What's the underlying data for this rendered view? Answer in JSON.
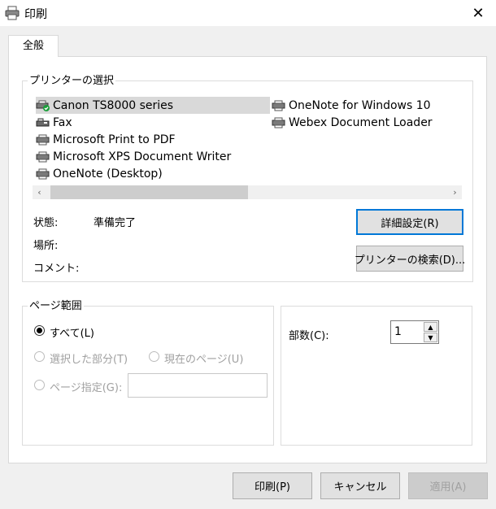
{
  "window": {
    "title": "印刷",
    "close_glyph": "✕",
    "icon": "printer-icon"
  },
  "tabs": [
    {
      "label": "全般",
      "active": true
    }
  ],
  "printer_select": {
    "group_label": "プリンターの選択",
    "printers_col1": [
      {
        "name": "Canon TS8000 series",
        "icon": "default-printer-icon",
        "selected": true
      },
      {
        "name": "Fax",
        "icon": "fax-icon",
        "selected": false
      },
      {
        "name": "Microsoft Print to PDF",
        "icon": "printer-icon",
        "selected": false
      },
      {
        "name": "Microsoft XPS Document Writer",
        "icon": "printer-icon",
        "selected": false
      },
      {
        "name": "OneNote (Desktop)",
        "icon": "printer-icon",
        "selected": false
      }
    ],
    "printers_col2": [
      {
        "name": "OneNote for Windows 10",
        "icon": "printer-icon",
        "selected": false
      },
      {
        "name": "Webex Document Loader",
        "icon": "printer-icon",
        "selected": false
      }
    ],
    "scroll_left": "‹",
    "scroll_right": "›",
    "status_label": "状態:",
    "status_value": "準備完了",
    "location_label": "場所:",
    "location_value": "",
    "comment_label": "コメント:",
    "comment_value": "",
    "preferences_button": "詳細設定(R)",
    "find_printer_button": "プリンターの検索(D)..."
  },
  "page_range": {
    "group_label": "ページ範囲",
    "all_label": "すべて(L)",
    "selection_label": "選択した部分(T)",
    "current_page_label": "現在のページ(U)",
    "pages_label": "ページ指定(G):",
    "pages_value": ""
  },
  "copies": {
    "label": "部数(C):",
    "value": "1"
  },
  "footer": {
    "print_button": "印刷(P)",
    "cancel_button": "キャンセル",
    "apply_button": "適用(A)"
  },
  "colors": {
    "focus_border": "#0078d7",
    "selected_item": "#d9d9d9",
    "disabled_text": "#a0a0a0"
  }
}
